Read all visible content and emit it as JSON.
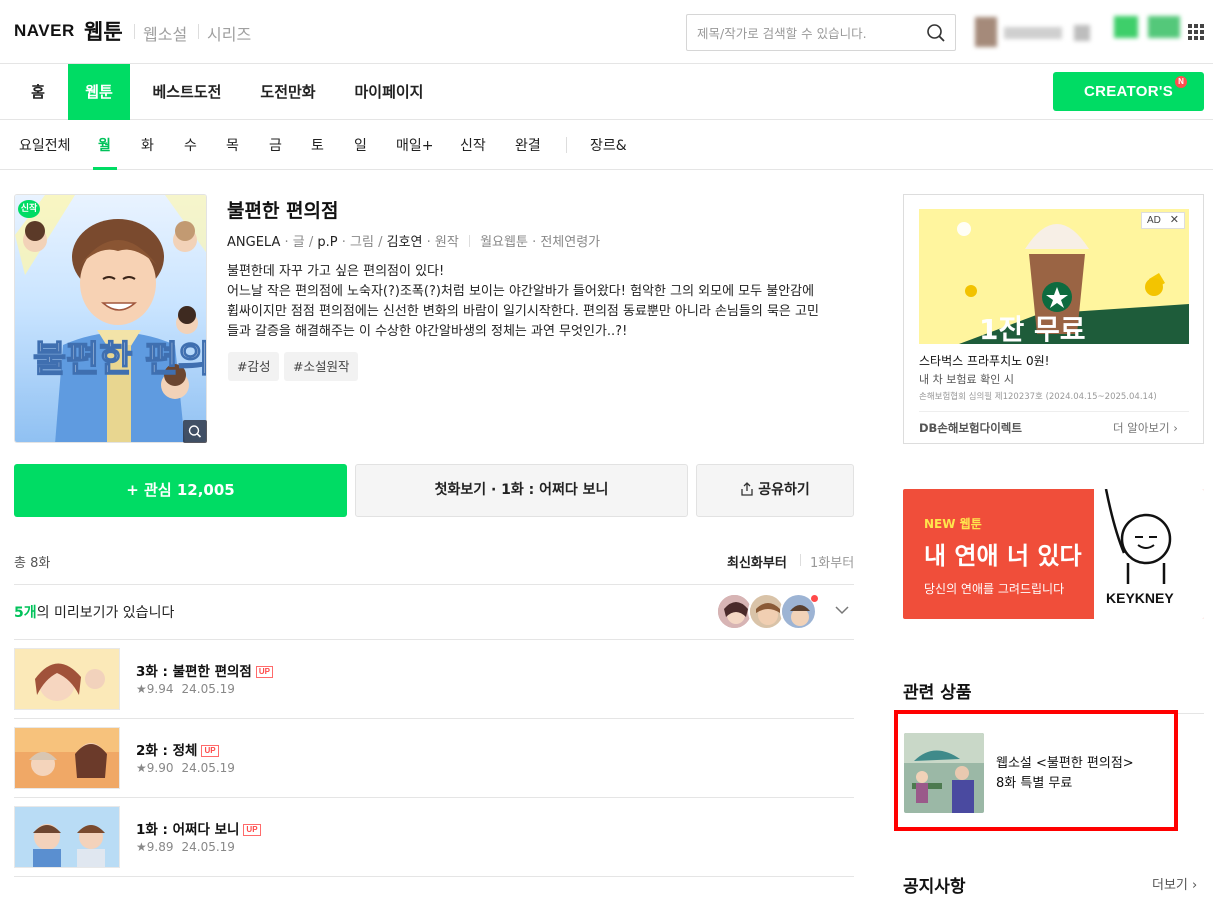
{
  "header": {
    "logo_naver": "NAVER",
    "logo_service": "웹툰",
    "links": [
      "웹소설",
      "시리즈"
    ],
    "search_placeholder": "제목/작가로 검색할 수 있습니다."
  },
  "main_nav": {
    "items": [
      "홈",
      "웹툰",
      "베스트도전",
      "도전만화",
      "마이페이지"
    ],
    "active": "웹툰",
    "creators_label": "CREATOR'S",
    "creators_badge": "N"
  },
  "sub_nav": {
    "items": [
      "요일전체",
      "월",
      "화",
      "수",
      "목",
      "금",
      "토",
      "일",
      "매일+",
      "신작",
      "완결",
      "장르&"
    ],
    "active": "월"
  },
  "comic": {
    "cover_badge": "신작",
    "cover_title_art": "불편한 편의점",
    "title": "불편한 편의점",
    "author1": "ANGELA",
    "role1": "· 글 /",
    "author2": "p.P",
    "role2": "· 그림 /",
    "author3": "김호연",
    "role3": "· 원작",
    "meta": "월요웹툰 · 전체연령가",
    "synopsis_lines": [
      "불편한데 자꾸 가고 싶은 편의점이 있다!",
      "어느날 작은 편의점에 노숙자(?)조폭(?)처럼 보이는 야간알바가 들어왔다! 험악한 그의 외모에 모두 불안감에",
      "휩싸이지만 점점 편의점에는 신선한 변화의 바람이 일기시작한다. 편의점 동료뿐만 아니라 손님들의 묵은 고민",
      "들과 갈증을 해결해주는 이 수상한 야간알바생의 정체는 과연 무엇인가..?!"
    ],
    "tags": [
      "#감성",
      "#소설원작"
    ]
  },
  "actions": {
    "favorite": "+ 관심 12,005",
    "first_episode": "첫화보기 · 1화 : 어쩌다 보니",
    "share": "공유하기"
  },
  "list": {
    "total": "총 8화",
    "sort_newest": "최신화부터",
    "sort_first": "1화부터",
    "preview_count": "5개",
    "preview_suffix": "의 미리보기가 있습니다",
    "episodes": [
      {
        "title": "3화 : 불편한 편의점",
        "badge": "UP",
        "rating": "9.94",
        "date": "24.05.19"
      },
      {
        "title": "2화 : 정체",
        "badge": "UP",
        "rating": "9.90",
        "date": "24.05.19"
      },
      {
        "title": "1화 : 어쩌다 보니",
        "badge": "UP",
        "rating": "9.89",
        "date": "24.05.19"
      }
    ]
  },
  "ad": {
    "badge": "AD",
    "image_text": "1잔 무료",
    "title": "스타벅스 프라푸치노 0원!",
    "subtitle": "내 차 보험료 확인 시",
    "fine_print": "손해보험협회 심의필 제120237호 (2024.04.15~2025.04.14)",
    "brand": "DB손해보험다이렉트",
    "more": "더 알아보기"
  },
  "banner": {
    "label": "NEW 웹툰",
    "title": "내 연애 너 있다",
    "subtitle": "당신의 연애를 그려드립니다",
    "brand": "KEYKNEY"
  },
  "related": {
    "heading": "관련 상품",
    "product_line1": "웹소설 <불편한 편의점>",
    "product_line2": "8화 특별 무료"
  },
  "notice": {
    "heading": "공지사항",
    "more": "더보기"
  },
  "colors": {
    "brand_green": "#00dc64",
    "highlight_red": "#ff0000",
    "banner_red": "#f04e3a"
  }
}
